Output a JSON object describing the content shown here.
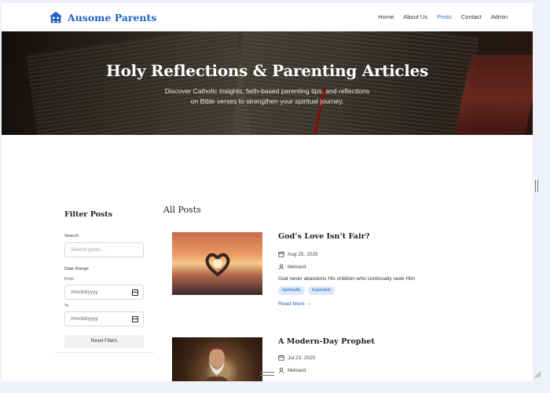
{
  "brand": {
    "name": "Ausome Parents",
    "icon": "house-family-icon",
    "color": "#1e63c4"
  },
  "nav": {
    "items": [
      {
        "label": "Home"
      },
      {
        "label": "About Us"
      },
      {
        "label": "Posts",
        "active": true
      },
      {
        "label": "Contact"
      },
      {
        "label": "Admin"
      }
    ]
  },
  "hero": {
    "title": "Holy Reflections & Parenting Articles",
    "subtitle_line1": "Discover Catholic insights, faith-based parenting tips, and reflections",
    "subtitle_line2": "on Bible verses to strengthen your spiritual journey."
  },
  "filter": {
    "title": "Filter Posts",
    "search_label": "Search",
    "search_placeholder": "Search posts...",
    "date_range_label": "Date Range",
    "from_label": "From",
    "from_value": "mm/dd/yyyy",
    "to_label": "To",
    "to_value": "mm/dd/yyyy",
    "reset_label": "Reset Filters"
  },
  "posts_section": {
    "title": "All Posts"
  },
  "posts": [
    {
      "title": "God’s Love Isn’t Fair?",
      "date": "Aug 25, 2025",
      "author": "Melnard",
      "excerpt": "God never abandons His children who continually seek Him",
      "tags": [
        "Spirituality",
        "Inspiration"
      ],
      "read_more": "Read More →",
      "image": "heart-hands-sunset-image"
    },
    {
      "title": "A Modern-Day Prophet",
      "date": "Jul 23, 2025",
      "author": "Melnard",
      "image": "prophet-portrait-image"
    }
  ],
  "colors": {
    "accent": "#1e73d6",
    "tag_bg": "#dbe8fb",
    "page_bg": "#eef1f8"
  }
}
